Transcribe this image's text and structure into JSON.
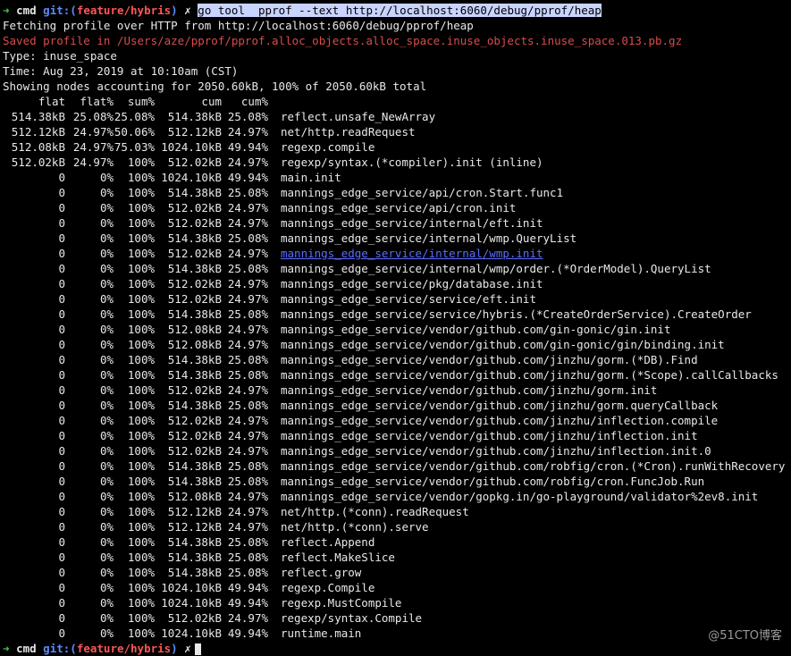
{
  "prompt": {
    "arrow": "➜",
    "cwd": "cmd",
    "git_prefix": "git:(",
    "branch": "feature/hybris",
    "git_suffix": ")",
    "mark": "✗",
    "command": "go tool  pprof --text http://localhost:6060/debug/pprof/heap"
  },
  "output": {
    "fetching": "Fetching profile over HTTP from http://localhost:6060/debug/pprof/heap",
    "saved": "Saved profile in /Users/aze/pprof/pprof.alloc_objects.alloc_space.inuse_objects.inuse_space.013.pb.gz",
    "type": "Type: inuse_space",
    "time": "Time: Aug 23, 2019 at 10:10am (CST)",
    "showing": "Showing nodes accounting for 2050.60kB, 100% of 2050.60kB total"
  },
  "table": {
    "headers": [
      "flat",
      "flat%",
      "sum%",
      "cum",
      "cum%"
    ],
    "rows": [
      [
        "514.38kB",
        "25.08%",
        "25.08%",
        "514.38kB",
        "25.08%",
        "reflect.unsafe_NewArray"
      ],
      [
        "512.12kB",
        "24.97%",
        "50.06%",
        "512.12kB",
        "24.97%",
        "net/http.readRequest"
      ],
      [
        "512.08kB",
        "24.97%",
        "75.03%",
        "1024.10kB",
        "49.94%",
        "regexp.compile"
      ],
      [
        "512.02kB",
        "24.97%",
        "100%",
        "512.02kB",
        "24.97%",
        "regexp/syntax.(*compiler).init (inline)"
      ],
      [
        "0",
        "0%",
        "100%",
        "1024.10kB",
        "49.94%",
        "main.init"
      ],
      [
        "0",
        "0%",
        "100%",
        "514.38kB",
        "25.08%",
        "mannings_edge_service/api/cron.Start.func1"
      ],
      [
        "0",
        "0%",
        "100%",
        "512.02kB",
        "24.97%",
        "mannings_edge_service/api/cron.init"
      ],
      [
        "0",
        "0%",
        "100%",
        "512.02kB",
        "24.97%",
        "mannings_edge_service/internal/eft.init"
      ],
      [
        "0",
        "0%",
        "100%",
        "514.38kB",
        "25.08%",
        "mannings_edge_service/internal/wmp.QueryList"
      ],
      [
        "0",
        "0%",
        "100%",
        "512.02kB",
        "24.97%",
        "mannings_edge_service/internal/wmp.init"
      ],
      [
        "0",
        "0%",
        "100%",
        "514.38kB",
        "25.08%",
        "mannings_edge_service/internal/wmp/order.(*OrderModel).QueryList"
      ],
      [
        "0",
        "0%",
        "100%",
        "512.02kB",
        "24.97%",
        "mannings_edge_service/pkg/database.init"
      ],
      [
        "0",
        "0%",
        "100%",
        "512.02kB",
        "24.97%",
        "mannings_edge_service/service/eft.init"
      ],
      [
        "0",
        "0%",
        "100%",
        "514.38kB",
        "25.08%",
        "mannings_edge_service/service/hybris.(*CreateOrderService).CreateOrder"
      ],
      [
        "0",
        "0%",
        "100%",
        "512.08kB",
        "24.97%",
        "mannings_edge_service/vendor/github.com/gin-gonic/gin.init"
      ],
      [
        "0",
        "0%",
        "100%",
        "512.08kB",
        "24.97%",
        "mannings_edge_service/vendor/github.com/gin-gonic/gin/binding.init"
      ],
      [
        "0",
        "0%",
        "100%",
        "514.38kB",
        "25.08%",
        "mannings_edge_service/vendor/github.com/jinzhu/gorm.(*DB).Find"
      ],
      [
        "0",
        "0%",
        "100%",
        "514.38kB",
        "25.08%",
        "mannings_edge_service/vendor/github.com/jinzhu/gorm.(*Scope).callCallbacks"
      ],
      [
        "0",
        "0%",
        "100%",
        "512.02kB",
        "24.97%",
        "mannings_edge_service/vendor/github.com/jinzhu/gorm.init"
      ],
      [
        "0",
        "0%",
        "100%",
        "514.38kB",
        "25.08%",
        "mannings_edge_service/vendor/github.com/jinzhu/gorm.queryCallback"
      ],
      [
        "0",
        "0%",
        "100%",
        "512.02kB",
        "24.97%",
        "mannings_edge_service/vendor/github.com/jinzhu/inflection.compile"
      ],
      [
        "0",
        "0%",
        "100%",
        "512.02kB",
        "24.97%",
        "mannings_edge_service/vendor/github.com/jinzhu/inflection.init"
      ],
      [
        "0",
        "0%",
        "100%",
        "512.02kB",
        "24.97%",
        "mannings_edge_service/vendor/github.com/jinzhu/inflection.init.0"
      ],
      [
        "0",
        "0%",
        "100%",
        "514.38kB",
        "25.08%",
        "mannings_edge_service/vendor/github.com/robfig/cron.(*Cron).runWithRecovery"
      ],
      [
        "0",
        "0%",
        "100%",
        "514.38kB",
        "25.08%",
        "mannings_edge_service/vendor/github.com/robfig/cron.FuncJob.Run"
      ],
      [
        "0",
        "0%",
        "100%",
        "512.08kB",
        "24.97%",
        "mannings_edge_service/vendor/gopkg.in/go-playground/validator%2ev8.init"
      ],
      [
        "0",
        "0%",
        "100%",
        "512.12kB",
        "24.97%",
        "net/http.(*conn).readRequest"
      ],
      [
        "0",
        "0%",
        "100%",
        "512.12kB",
        "24.97%",
        "net/http.(*conn).serve"
      ],
      [
        "0",
        "0%",
        "100%",
        "514.38kB",
        "25.08%",
        "reflect.Append"
      ],
      [
        "0",
        "0%",
        "100%",
        "514.38kB",
        "25.08%",
        "reflect.MakeSlice"
      ],
      [
        "0",
        "0%",
        "100%",
        "514.38kB",
        "25.08%",
        "reflect.grow"
      ],
      [
        "0",
        "0%",
        "100%",
        "1024.10kB",
        "49.94%",
        "regexp.Compile"
      ],
      [
        "0",
        "0%",
        "100%",
        "1024.10kB",
        "49.94%",
        "regexp.MustCompile"
      ],
      [
        "0",
        "0%",
        "100%",
        "512.02kB",
        "24.97%",
        "regexp/syntax.Compile"
      ],
      [
        "0",
        "0%",
        "100%",
        "1024.10kB",
        "49.94%",
        "runtime.main"
      ]
    ],
    "link_row_index": 9
  },
  "watermark": "@51CTO博客"
}
